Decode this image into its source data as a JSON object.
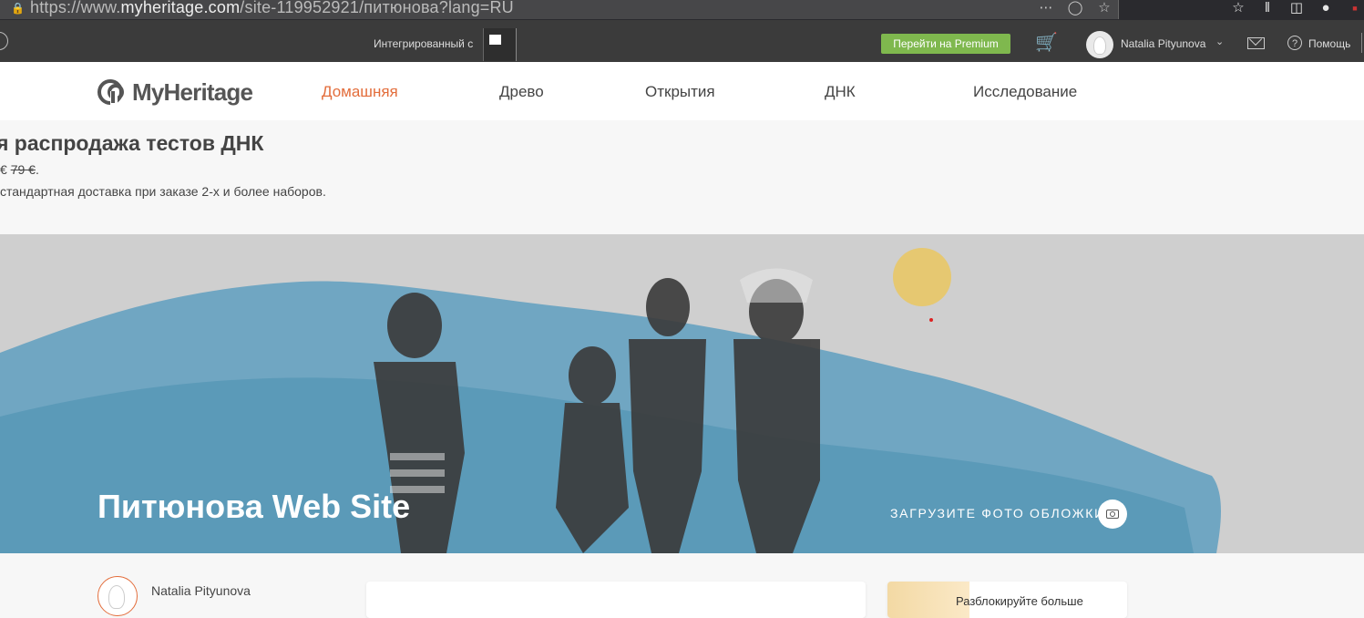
{
  "browser": {
    "url_prefix": "https://www.",
    "url_host": "myheritage.com",
    "url_path": "/site-119952921/питюнова?lang=RU"
  },
  "topbar": {
    "integrated_label": "Интегрированный с",
    "premium_button": "Перейти на Premium",
    "user_name": "Natalia Pityunova",
    "help_label": "Помощь"
  },
  "nav": {
    "logo_text": "MyHeritage",
    "items": [
      {
        "label": "Домашняя",
        "active": true
      },
      {
        "label": "Древо",
        "active": false
      },
      {
        "label": "Открытия",
        "active": false
      },
      {
        "label": "ДНК",
        "active": false
      },
      {
        "label": "Исследование",
        "active": false
      }
    ]
  },
  "promo": {
    "title": "я распродажа тестов ДНК",
    "price_prefix": "€",
    "old_price": "79 €",
    "price_suffix": ".",
    "shipping": "стандартная доставка при заказе 2-х и более наборов."
  },
  "hero": {
    "site_title": "Питюнова Web Site",
    "upload_cover": "ЗАГРУЗИТЕ ФОТО ОБЛОЖКИ"
  },
  "profile": {
    "name": "Natalia Pityunova"
  },
  "sidebar_card": {
    "text": "Разблокируйте больше"
  },
  "colors": {
    "accent": "#e36d3b",
    "premium": "#7fb84e",
    "topbar": "#3b3b3b",
    "hero_bg": "#cfcfcf",
    "water": "#5a9bbb"
  }
}
